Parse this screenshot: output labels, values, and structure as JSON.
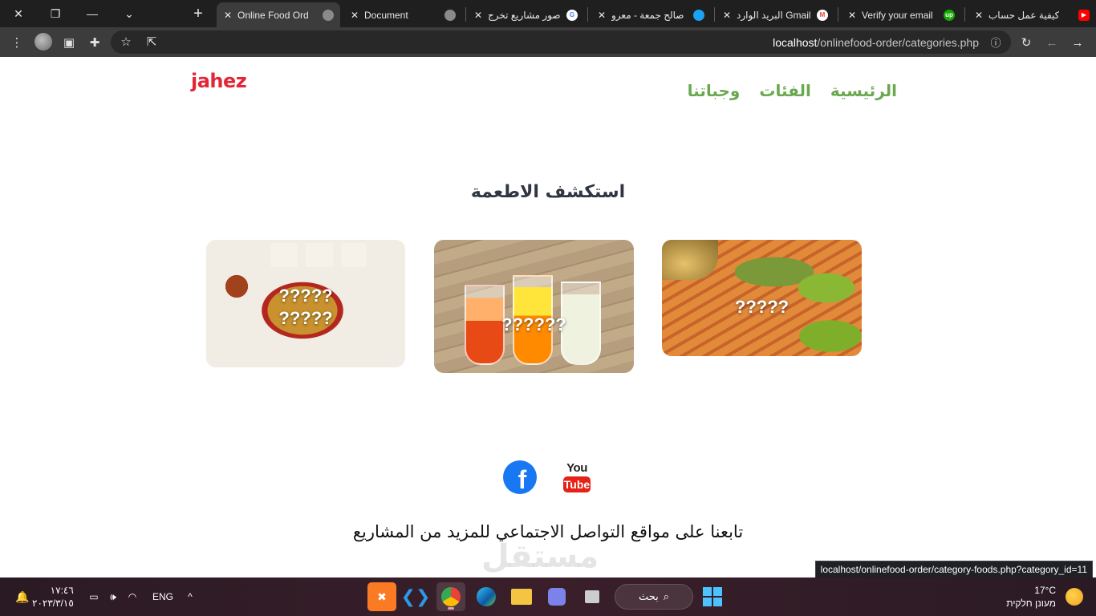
{
  "browser": {
    "tabs": [
      {
        "label": "Online Food Ord",
        "active": true,
        "icon": "globe-icon"
      },
      {
        "label": "Document",
        "active": false,
        "icon": "globe-icon"
      },
      {
        "label": "صور مشاريع تخرج",
        "active": false,
        "icon": "google-icon"
      },
      {
        "label": "صالح جمعة - معرو",
        "active": false,
        "icon": "circle-icon"
      },
      {
        "label": "البريد الوارد Gmail",
        "active": false,
        "icon": "gmail-icon"
      },
      {
        "label": "Verify your email",
        "active": false,
        "icon": "upwork-icon"
      },
      {
        "label": "كيفية عمل حساب",
        "active": false,
        "icon": "youtube-icon"
      }
    ],
    "url_host": "localhost",
    "url_path": "/onlinefood-order/categories.php",
    "status_url": "localhost/onlinefood-order/category-foods.php?category_id=11"
  },
  "site": {
    "logo": "Jahez",
    "nav": [
      "الرئيسية",
      "الفئات",
      "وجباتنا"
    ],
    "section_title": "استكشف الاطعمة",
    "categories": [
      {
        "caption": "?????\n?????"
      },
      {
        "caption": "??????"
      },
      {
        "caption": "?????"
      }
    ],
    "social": {
      "facebook": "f",
      "youtube_top": "You",
      "youtube_bottom": "Tube"
    },
    "follow_text": "تابعنا على مواقع التواصل الاجتماعي للمزيد من المشاريع",
    "watermark": "مستقل"
  },
  "taskbar": {
    "time": "١٧:٤٦",
    "date": "٢٠٢٣/٣/١٥",
    "lang": "ENG",
    "search": "بحث",
    "temperature": "17°C",
    "weather_desc": "מעונן חלקית"
  },
  "colors": {
    "brand": "#e32636",
    "nav": "#6aa84f",
    "facebook": "#1877f2",
    "youtube": "#e62117"
  }
}
